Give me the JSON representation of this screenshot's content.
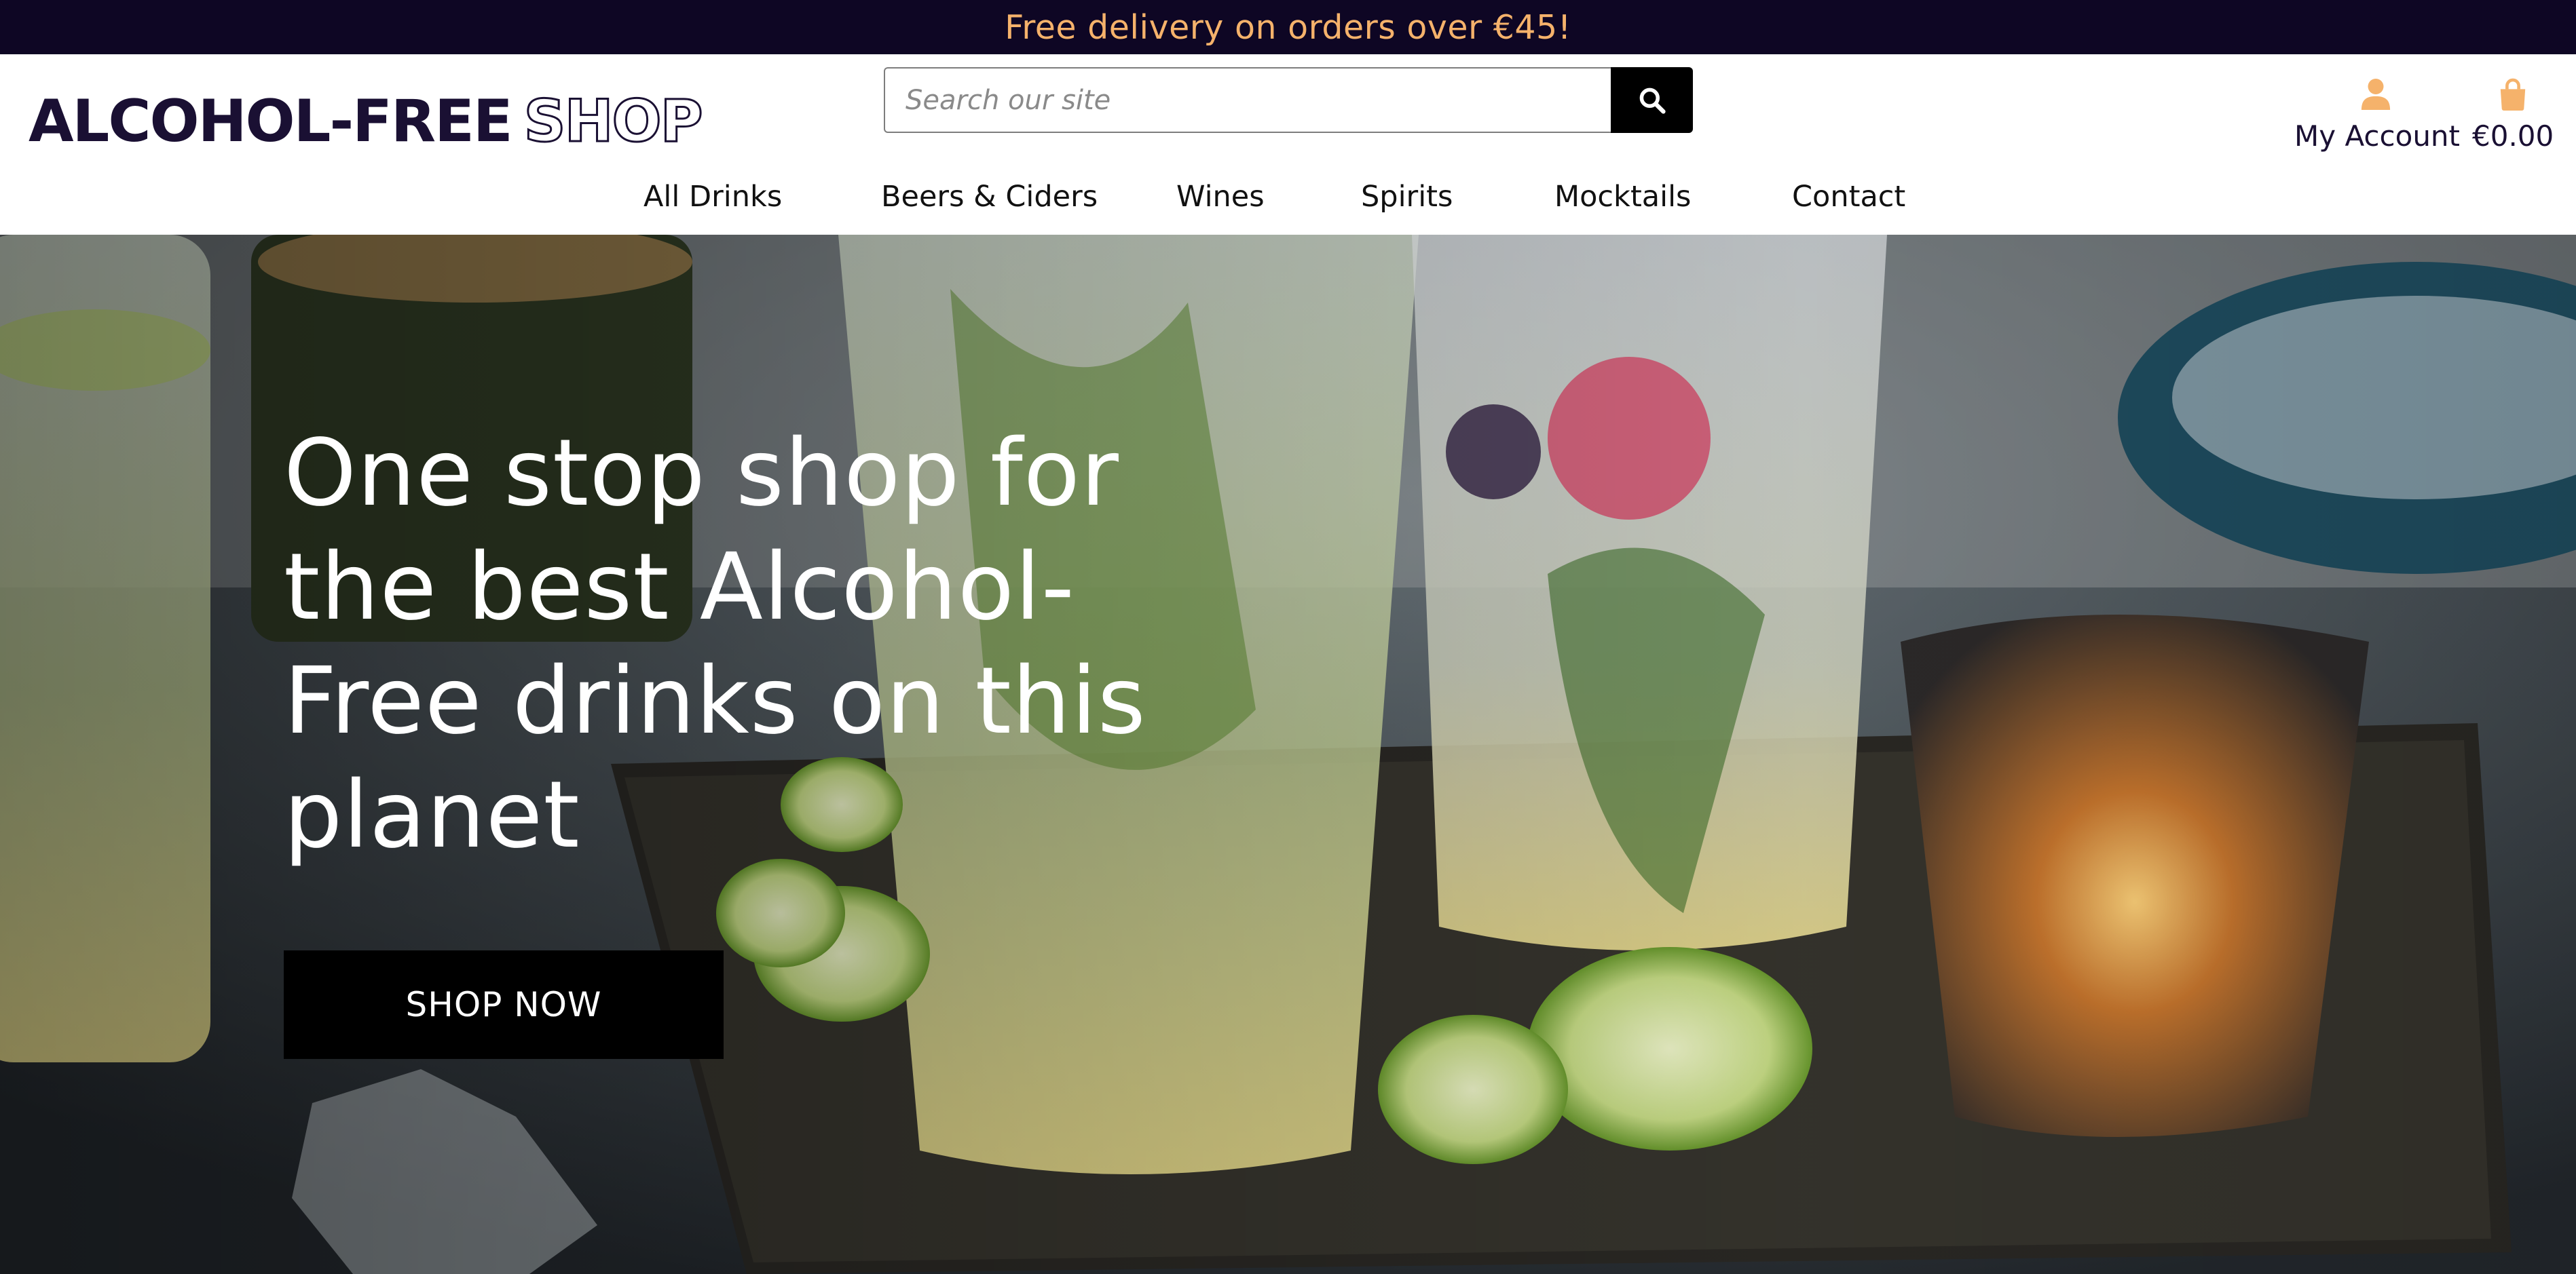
{
  "banner": {
    "text": "Free delivery on orders over €45!"
  },
  "header": {
    "logo_main": "ALCOHOL-FREE",
    "logo_accent": "SHOP",
    "search": {
      "placeholder": "Search our site",
      "icon": "search-icon"
    },
    "account": {
      "label": "My Account",
      "icon": "user-icon"
    },
    "cart": {
      "total": "€0.00",
      "icon": "shopping-bag-icon"
    }
  },
  "nav": {
    "items": [
      {
        "label": "All Drinks"
      },
      {
        "label": "Beers & Ciders"
      },
      {
        "label": "Wines"
      },
      {
        "label": "Spirits"
      },
      {
        "label": "Mocktails"
      },
      {
        "label": "Contact"
      }
    ]
  },
  "hero": {
    "title": "One stop shop for the best Alcohol-Free drinks on this planet",
    "cta_label": "SHOP NOW"
  },
  "colors": {
    "banner_bg": "#0e0624",
    "banner_text": "#f5b26b",
    "brand_dark": "#1a1033",
    "accent": "#f5b26b",
    "button_bg": "#000000"
  }
}
